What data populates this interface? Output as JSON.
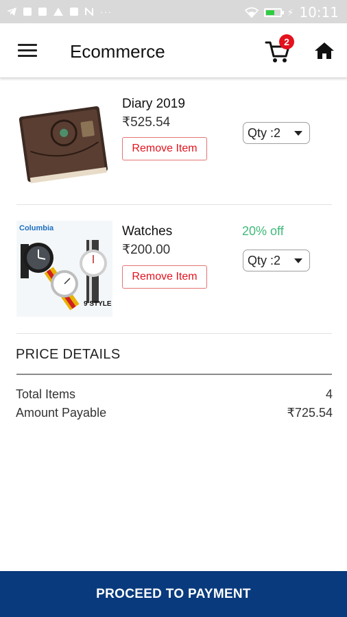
{
  "status_bar": {
    "time": "10:11",
    "overflow": "···",
    "left_icons": [
      "telegram-icon",
      "mail-icon",
      "image-icon",
      "upload-icon",
      "gamepad-icon",
      "n-icon"
    ],
    "right_icons": [
      "wifi-icon",
      "battery-icon",
      "charging-icon"
    ],
    "battery_color": "#2ecc40"
  },
  "app_bar": {
    "title": "Ecommerce",
    "cart_count": "2",
    "icons": [
      "menu-icon",
      "cart-icon",
      "home-icon"
    ]
  },
  "items": [
    {
      "name": "Diary 2019",
      "price": "₹525.54",
      "remove_label": "Remove Item",
      "qty_label": "Qty :2",
      "discount": ""
    },
    {
      "name": "Watches",
      "price": "₹200.00",
      "remove_label": "Remove Item",
      "qty_label": "Qty :2",
      "discount": "20% off",
      "image_brand": "Columbia",
      "image_caption": "9 STYLE"
    }
  ],
  "price_details": {
    "title": "PRICE DETAILS",
    "total_items_label": "Total Items",
    "total_items_value": "4",
    "amount_label": "Amount Payable",
    "amount_value": "₹725.54"
  },
  "proceed_label": "PROCEED TO PAYMENT",
  "colors": {
    "accent": "#093a7d",
    "remove_text": "#e4121c",
    "discount": "#3fb97a",
    "badge": "#e4121c"
  }
}
